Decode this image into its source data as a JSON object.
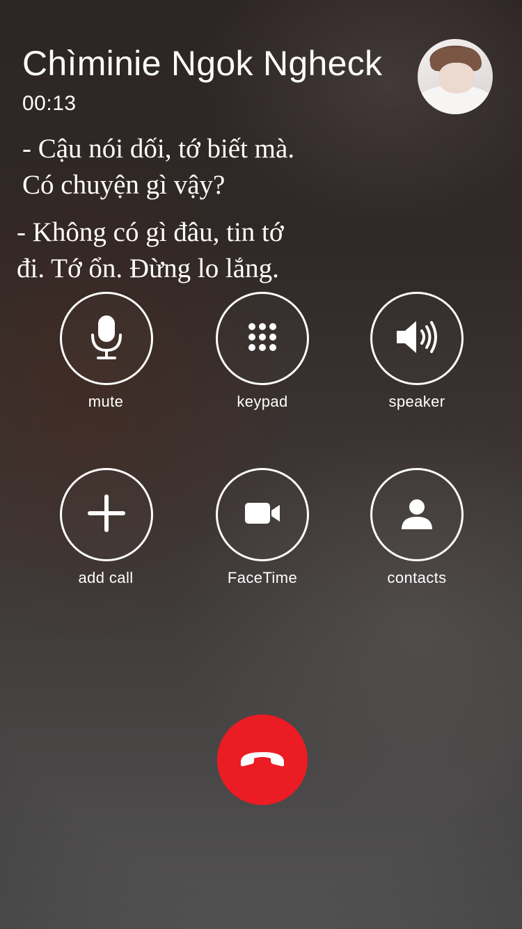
{
  "call": {
    "caller_name": "Chìminie Ngok Ngheck",
    "duration": "00:13"
  },
  "overlay": {
    "quote_1_line_1": "- Cậu nói dối, tớ biết mà.",
    "quote_1_line_2": "Có chuyện gì vậy?",
    "quote_2_line_1": "- Không có gì đâu, tin tớ",
    "quote_2_line_2": "đi. Tớ ổn. Đừng lo lắng."
  },
  "controls": {
    "mute": {
      "label": "mute",
      "icon": "microphone-icon"
    },
    "keypad": {
      "label": "keypad",
      "icon": "keypad-icon"
    },
    "speaker": {
      "label": "speaker",
      "icon": "speaker-icon"
    },
    "add_call": {
      "label": "add call",
      "icon": "plus-icon"
    },
    "facetime": {
      "label": "FaceTime",
      "icon": "video-camera-icon"
    },
    "contacts": {
      "label": "contacts",
      "icon": "person-icon"
    }
  },
  "end_call": {
    "icon": "hang-up-phone-icon",
    "color": "#eb1c24"
  }
}
